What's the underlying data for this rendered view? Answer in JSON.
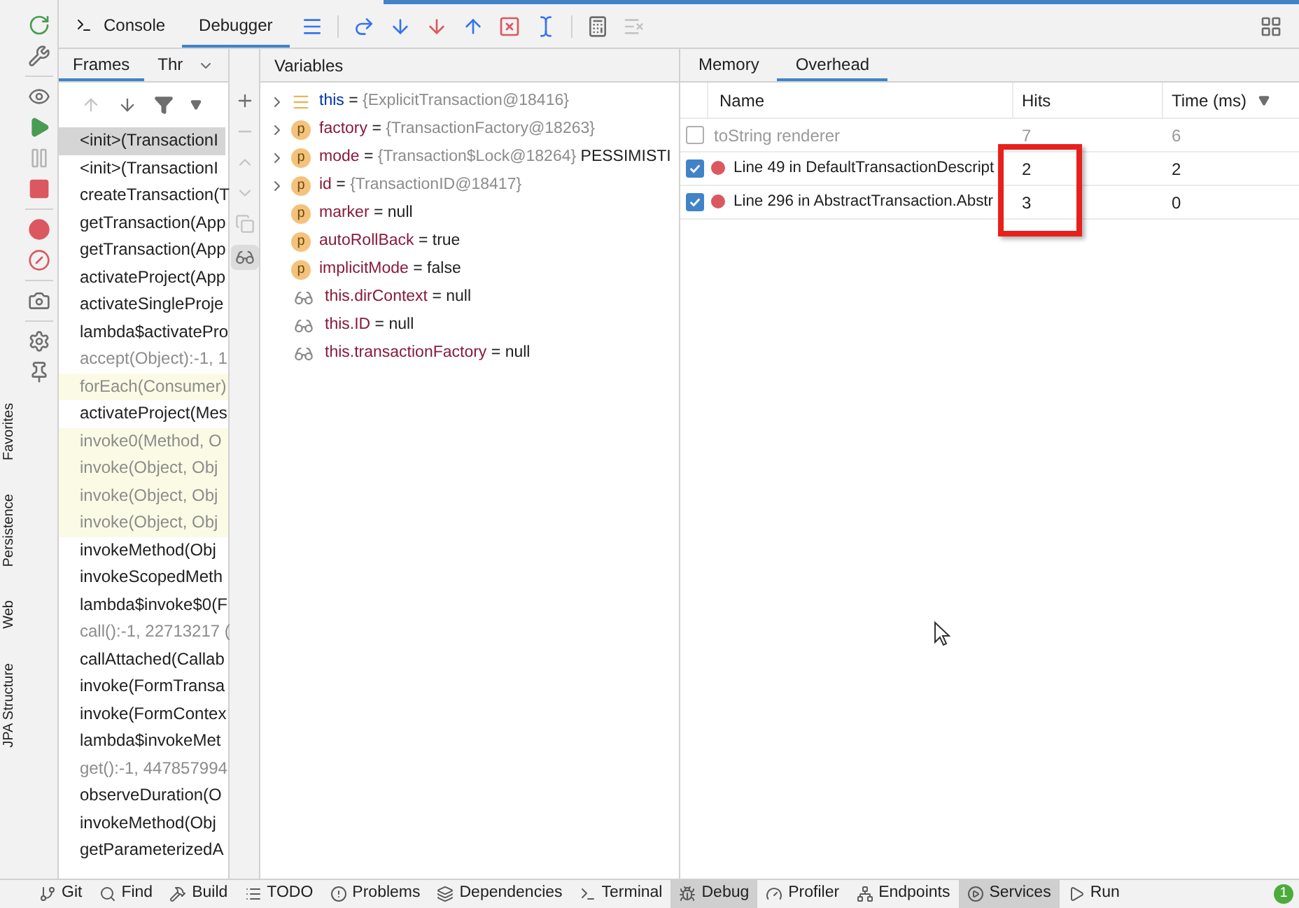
{
  "side_labels": [
    "Favorites",
    "Persistence",
    "Web",
    "JPA Structure"
  ],
  "debug_tabs": [
    {
      "label": "Console",
      "selected": false
    },
    {
      "label": "Debugger",
      "selected": true
    }
  ],
  "frames_panel": {
    "tabs": [
      {
        "label": "Frames",
        "selected": true
      },
      {
        "label": "Thr",
        "selected": false
      }
    ],
    "frames": [
      {
        "text": "<init>(TransactionI",
        "selected": true,
        "library": false,
        "highlighted": false
      },
      {
        "text": "<init>(TransactionI",
        "selected": false,
        "library": false,
        "highlighted": false
      },
      {
        "text": "createTransaction(T",
        "selected": false,
        "library": false,
        "highlighted": false
      },
      {
        "text": "getTransaction(App",
        "selected": false,
        "library": false,
        "highlighted": false
      },
      {
        "text": "getTransaction(App",
        "selected": false,
        "library": false,
        "highlighted": false
      },
      {
        "text": "activateProject(App",
        "selected": false,
        "library": false,
        "highlighted": false
      },
      {
        "text": "activateSingleProje",
        "selected": false,
        "library": false,
        "highlighted": false
      },
      {
        "text": "lambda$activatePro",
        "selected": false,
        "library": false,
        "highlighted": false
      },
      {
        "text": "accept(Object):-1, 1",
        "selected": false,
        "library": true,
        "highlighted": false
      },
      {
        "text": "forEach(Consumer)",
        "selected": false,
        "library": true,
        "highlighted": true
      },
      {
        "text": "activateProject(Mes",
        "selected": false,
        "library": false,
        "highlighted": false
      },
      {
        "text": "invoke0(Method, O",
        "selected": false,
        "library": true,
        "highlighted": true
      },
      {
        "text": "invoke(Object, Obj",
        "selected": false,
        "library": true,
        "highlighted": true
      },
      {
        "text": "invoke(Object, Obj",
        "selected": false,
        "library": true,
        "highlighted": true
      },
      {
        "text": "invoke(Object, Obj",
        "selected": false,
        "library": true,
        "highlighted": true
      },
      {
        "text": "invokeMethod(Obj",
        "selected": false,
        "library": false,
        "highlighted": false
      },
      {
        "text": "invokeScopedMeth",
        "selected": false,
        "library": false,
        "highlighted": false
      },
      {
        "text": "lambda$invoke$0(F",
        "selected": false,
        "library": false,
        "highlighted": false
      },
      {
        "text": "call():-1, 22713217 (",
        "selected": false,
        "library": true,
        "highlighted": false
      },
      {
        "text": "callAttached(Callab",
        "selected": false,
        "library": false,
        "highlighted": false
      },
      {
        "text": "invoke(FormTransa",
        "selected": false,
        "library": false,
        "highlighted": false
      },
      {
        "text": "invoke(FormContex",
        "selected": false,
        "library": false,
        "highlighted": false
      },
      {
        "text": "lambda$invokeMet",
        "selected": false,
        "library": false,
        "highlighted": false
      },
      {
        "text": "get():-1, 447857994",
        "selected": false,
        "library": true,
        "highlighted": false
      },
      {
        "text": "observeDuration(O",
        "selected": false,
        "library": false,
        "highlighted": false
      },
      {
        "text": "invokeMethod(Obj",
        "selected": false,
        "library": false,
        "highlighted": false
      },
      {
        "text": "getParameterizedA",
        "selected": false,
        "library": false,
        "highlighted": false
      }
    ]
  },
  "variables_panel": {
    "title": "Variables",
    "variables": [
      {
        "kind": "object",
        "name": "this",
        "operator": "=",
        "value": "{ExplicitTransaction@18416}",
        "expandable": true
      },
      {
        "kind": "field",
        "badge": "p",
        "name": "factory",
        "operator": "=",
        "value": "{TransactionFactory@18263}",
        "expandable": true
      },
      {
        "kind": "field",
        "badge": "p",
        "name": "mode",
        "operator": "=",
        "value": "{Transaction$Lock@18264}",
        "suffix": "PESSIMISTI",
        "expandable": true
      },
      {
        "kind": "field",
        "badge": "p",
        "name": "id",
        "operator": "=",
        "value": "{TransactionID@18417}",
        "expandable": true
      },
      {
        "kind": "field",
        "badge": "p",
        "name": "marker",
        "operator": "=",
        "result": "null",
        "expandable": false
      },
      {
        "kind": "field",
        "badge": "p",
        "name": "autoRollBack",
        "operator": "=",
        "result": "true",
        "expandable": false
      },
      {
        "kind": "field",
        "badge": "p",
        "name": "implicitMode",
        "operator": "=",
        "result": "false",
        "expandable": false
      },
      {
        "kind": "watch",
        "name": "this.dirContext",
        "operator": "=",
        "result": "null",
        "expandable": false
      },
      {
        "kind": "watch",
        "name": "this.ID",
        "operator": "=",
        "result": "null",
        "expandable": false
      },
      {
        "kind": "watch",
        "name": "this.transactionFactory",
        "operator": "=",
        "result": "null",
        "expandable": false
      }
    ]
  },
  "overhead_panel": {
    "tabs": [
      {
        "label": "Memory",
        "selected": false
      },
      {
        "label": "Overhead",
        "selected": true
      }
    ],
    "columns": [
      "Name",
      "Hits",
      "Time (ms)"
    ],
    "rows": [
      {
        "kind": "renderer",
        "checked": false,
        "enabled": false,
        "name": "toString renderer",
        "hits": "7",
        "time": "6"
      },
      {
        "kind": "breakpoint",
        "checked": true,
        "enabled": true,
        "name": "Line 49 in DefaultTransactionDescript",
        "hits": "2",
        "time": "2"
      },
      {
        "kind": "breakpoint",
        "checked": true,
        "enabled": true,
        "name": "Line 296 in AbstractTransaction.Abstr",
        "hits": "3",
        "time": "0"
      }
    ]
  },
  "status_bar": {
    "tools": [
      {
        "kind": "git",
        "label": "Git",
        "selected": false
      },
      {
        "kind": "find",
        "label": "Find",
        "selected": false
      },
      {
        "kind": "build",
        "label": "Build",
        "selected": false
      },
      {
        "kind": "todo",
        "label": "TODO",
        "selected": false
      },
      {
        "kind": "problems",
        "label": "Problems",
        "selected": false
      },
      {
        "kind": "dependencies",
        "label": "Dependencies",
        "selected": false
      },
      {
        "kind": "terminal",
        "label": "Terminal",
        "selected": false
      },
      {
        "kind": "debug",
        "label": "Debug",
        "selected": true
      },
      {
        "kind": "profiler",
        "label": "Profiler",
        "selected": false
      },
      {
        "kind": "endpoints",
        "label": "Endpoints",
        "selected": false
      },
      {
        "kind": "services",
        "label": "Services",
        "selected": true
      },
      {
        "kind": "run",
        "label": "Run",
        "selected": false
      }
    ],
    "badge": "1"
  }
}
